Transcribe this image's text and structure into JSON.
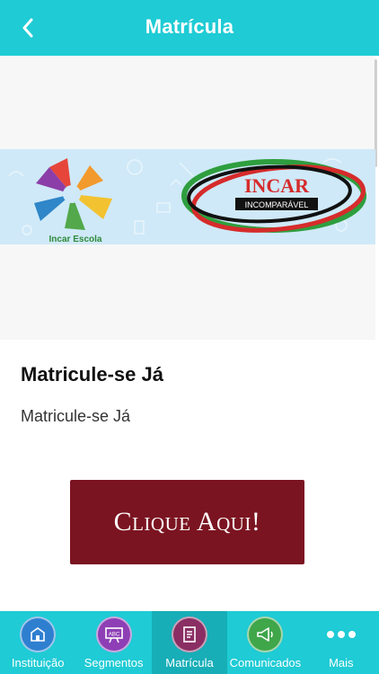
{
  "header": {
    "title": "Matrícula",
    "back_icon": "chevron-left-icon",
    "background": "#1fcbd5"
  },
  "banner": {
    "left_logo_text": "Incar Escola",
    "right_logo_text": "INCAR",
    "right_logo_subtext": "INCOMPARÁVEL"
  },
  "content": {
    "title": "Matricule-se Já",
    "subtitle": "Matricule-se Já",
    "cta_label": "Clique Aqui!",
    "cta_color": "#7b1421"
  },
  "tabbar": {
    "items": [
      {
        "label": "Instituição",
        "icon": "school-building-icon",
        "color": "#2f7fd0"
      },
      {
        "label": "Segmentos",
        "icon": "chalkboard-abc-icon",
        "color": "#8e3fb5"
      },
      {
        "label": "Matrícula",
        "icon": "enrollment-document-icon",
        "color": "#8a2e63"
      },
      {
        "label": "Comunicados",
        "icon": "megaphone-icon",
        "color": "#3fa64a"
      },
      {
        "label": "Mais",
        "icon": "more-dots-icon"
      }
    ]
  }
}
